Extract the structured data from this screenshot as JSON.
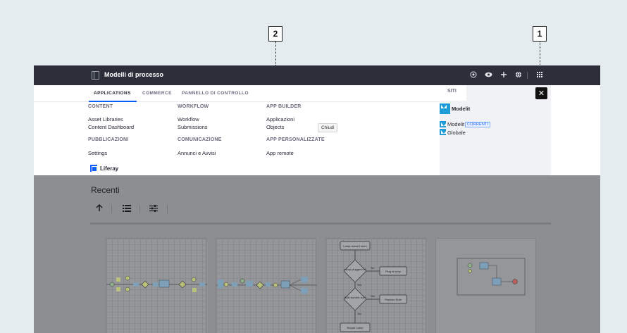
{
  "callouts": {
    "one": "1",
    "two": "2"
  },
  "topbar": {
    "title": "Modelli di processo",
    "icons": [
      "panel-toggle-icon",
      "target-icon",
      "eye-icon",
      "plus-icon",
      "globe-icon",
      "apps-grid-icon"
    ]
  },
  "menu": {
    "tabs": [
      "APPLICATIONS",
      "COMMERCE",
      "PANNELLO DI CONTROLLO"
    ],
    "columns": {
      "content": {
        "heading": "CONTENT",
        "links": [
          "Asset Libraries",
          "Content Dashboard"
        ]
      },
      "pubblicazioni": {
        "heading": "PUBBLICAZIONI",
        "links": [
          "Settings"
        ]
      },
      "workflow": {
        "heading": "WORKFLOW",
        "links": [
          "Workflow",
          "Submissions"
        ]
      },
      "comunicazione": {
        "heading": "COMUNICAZIONE",
        "links": [
          "Annunci e Avvisi"
        ]
      },
      "app_builder": {
        "heading": "APP BUILDER",
        "links": [
          "Applicazioni",
          "Objects"
        ]
      },
      "app_personalizzate": {
        "heading": "APP PERSONALIZZATE",
        "links": [
          "App remote"
        ]
      }
    },
    "tooltip": "Chiudi",
    "brand": "Liferay"
  },
  "sites": {
    "heading": "SITI",
    "featured": "Modelit",
    "list": [
      "Modelit",
      "Globale"
    ],
    "badge": "CORRENTI"
  },
  "main": {
    "heading": "Recenti",
    "cards": [
      {
        "labels": []
      },
      {
        "labels": []
      },
      {
        "labels": [
          "Lamp doesn't work",
          "Lamp plugged in?",
          "No",
          "Plug in lamp",
          "Yes",
          "Bulb burned out?",
          "Yes",
          "Replace Bulb",
          "No",
          "Repair Lamp"
        ]
      },
      {
        "labels": []
      }
    ]
  },
  "colors": {
    "topbar": "#2c2f3a",
    "accent": "#0b5fff",
    "site_logo": "#1d9cd8",
    "overlay": "#8d8e91"
  }
}
